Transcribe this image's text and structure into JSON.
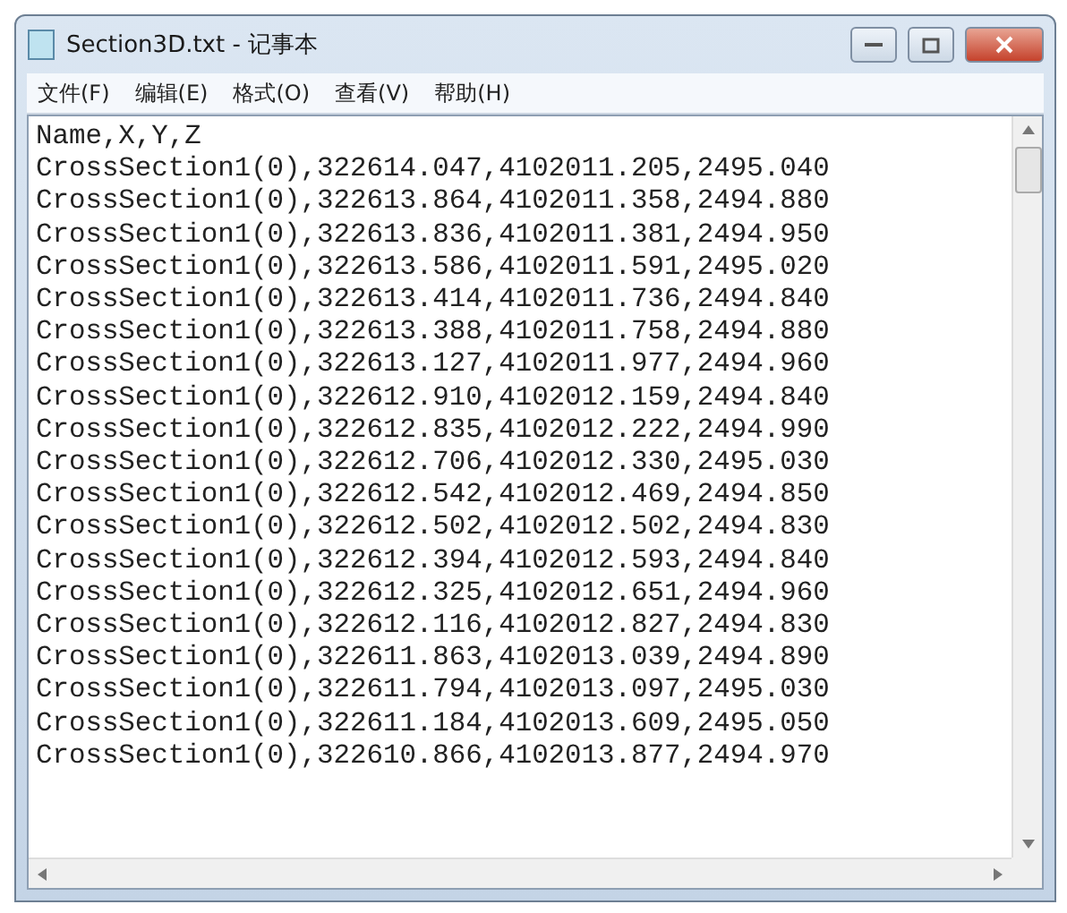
{
  "window": {
    "title": "Section3D.txt - 记事本"
  },
  "menu": [
    "文件(F)",
    "编辑(E)",
    "格式(O)",
    "查看(V)",
    "帮助(H)"
  ],
  "lines": [
    "Name,X,Y,Z",
    "CrossSection1(0),322614.047,4102011.205,2495.040",
    "CrossSection1(0),322613.864,4102011.358,2494.880",
    "CrossSection1(0),322613.836,4102011.381,2494.950",
    "CrossSection1(0),322613.586,4102011.591,2495.020",
    "CrossSection1(0),322613.414,4102011.736,2494.840",
    "CrossSection1(0),322613.388,4102011.758,2494.880",
    "CrossSection1(0),322613.127,4102011.977,2494.960",
    "CrossSection1(0),322612.910,4102012.159,2494.840",
    "CrossSection1(0),322612.835,4102012.222,2494.990",
    "CrossSection1(0),322612.706,4102012.330,2495.030",
    "CrossSection1(0),322612.542,4102012.469,2494.850",
    "CrossSection1(0),322612.502,4102012.502,2494.830",
    "CrossSection1(0),322612.394,4102012.593,2494.840",
    "CrossSection1(0),322612.325,4102012.651,2494.960",
    "CrossSection1(0),322612.116,4102012.827,2494.830",
    "CrossSection1(0),322611.863,4102013.039,2494.890",
    "CrossSection1(0),322611.794,4102013.097,2495.030",
    "CrossSection1(0),322611.184,4102013.609,2495.050",
    "CrossSection1(0),322610.866,4102013.877,2494.970"
  ]
}
